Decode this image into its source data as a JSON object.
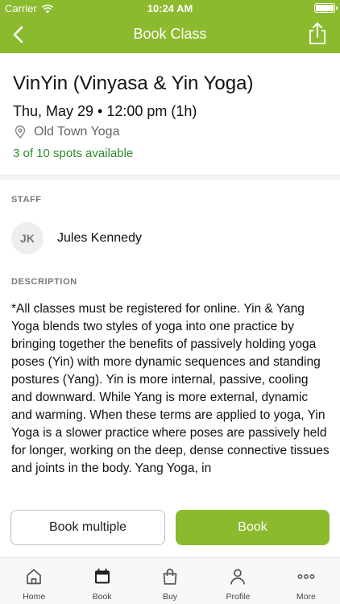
{
  "status_bar": {
    "carrier": "Carrier",
    "time": "10:24 AM"
  },
  "nav": {
    "title": "Book Class"
  },
  "class_info": {
    "title": "VinYin (Vinyasa & Yin Yoga)",
    "datetime": "Thu, May 29 • 12:00 pm (1h)",
    "location": "Old Town Yoga",
    "spots": "3 of 10 spots available"
  },
  "staff": {
    "section_label": "STAFF",
    "initials": "JK",
    "name": "Jules Kennedy"
  },
  "description": {
    "section_label": "DESCRIPTION",
    "text": "*All classes must be registered for online. Yin & Yang Yoga blends two styles of yoga into one practice by bringing together the benefits of passively holding yoga poses (Yin) with more dynamic sequences and standing postures (Yang). Yin is more internal, passive, cooling and downward. While Yang is more external, dynamic and warming. When these terms are applied to yoga, Yin Yoga is a slower practice where poses are passively held for longer, working on the deep, dense connective tissues and joints in the body. Yang Yoga, in"
  },
  "actions": {
    "secondary_label": "Book multiple",
    "primary_label": "Book"
  },
  "tabs": [
    {
      "label": "Home",
      "icon": "home-icon"
    },
    {
      "label": "Book",
      "icon": "calendar-icon",
      "active": true
    },
    {
      "label": "Buy",
      "icon": "shopping-bag-icon"
    },
    {
      "label": "Profile",
      "icon": "person-icon"
    },
    {
      "label": "More",
      "icon": "more-dots-icon"
    }
  ],
  "colors": {
    "brand": "#8cba2e",
    "spots": "#2e8b2e",
    "muted": "#777777"
  }
}
